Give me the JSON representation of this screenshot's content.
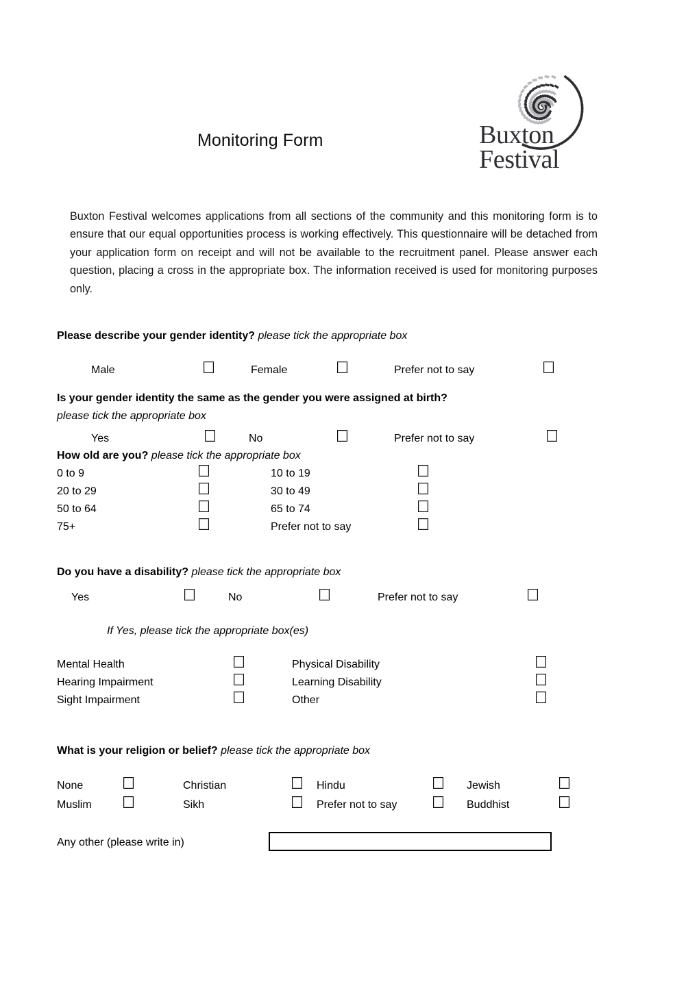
{
  "document": {
    "title": "Monitoring Form",
    "logo": {
      "name": "Buxton Festival",
      "line1": "Buxton",
      "line2": "Festival"
    },
    "intro": "Buxton Festival welcomes applications from all sections of the community and this monitoring form is to ensure that our equal opportunities process is working effectively. This questionnaire will be detached from your application form on receipt and will not be available to the recruitment panel. Please answer each question, placing a cross in the appropriate box. The information received is used for monitoring purposes only."
  },
  "sections": {
    "gender_identity": {
      "question": "Please describe your gender identity?",
      "hint": "please tick the appropriate box",
      "options": [
        "Male",
        "Female",
        "Prefer not to say"
      ]
    },
    "gender_same_as_birth": {
      "question": "Is your gender identity the same as the gender you were assigned at birth?",
      "hint": "please tick the appropriate box",
      "options": [
        "Yes",
        "No",
        "Prefer not to say"
      ]
    },
    "age": {
      "question": "How old are you?",
      "hint": "please tick the appropriate box",
      "options_left": [
        "0 to 9",
        "20 to 29",
        "50 to 64",
        "75+"
      ],
      "options_right": [
        "10 to 19",
        "30 to 49",
        "65 to 74",
        "Prefer not to say"
      ]
    },
    "disability": {
      "question": "Do you have a disability?",
      "hint": "please tick the appropriate box",
      "options": [
        "Yes",
        "No",
        "Prefer not to say"
      ],
      "followup": "If Yes, please tick the appropriate box(es)",
      "types_left": [
        "Mental Health",
        "Hearing Impairment",
        "Sight Impairment"
      ],
      "types_right": [
        "Physical Disability",
        "Learning Disability",
        "Other"
      ]
    },
    "religion": {
      "question": "What is your religion or belief?",
      "hint": "please tick the appropriate box",
      "row1": [
        "None",
        "Christian",
        "Hindu",
        "Jewish"
      ],
      "row2": [
        "Muslim",
        "Sikh",
        "Prefer not to say",
        "Buddhist"
      ],
      "other_label": "Any other (please write in)",
      "other_value": ""
    }
  },
  "colors": {
    "text": "#000000",
    "logo_dark": "#2f2f33",
    "logo_light": "#b9b9bd"
  }
}
